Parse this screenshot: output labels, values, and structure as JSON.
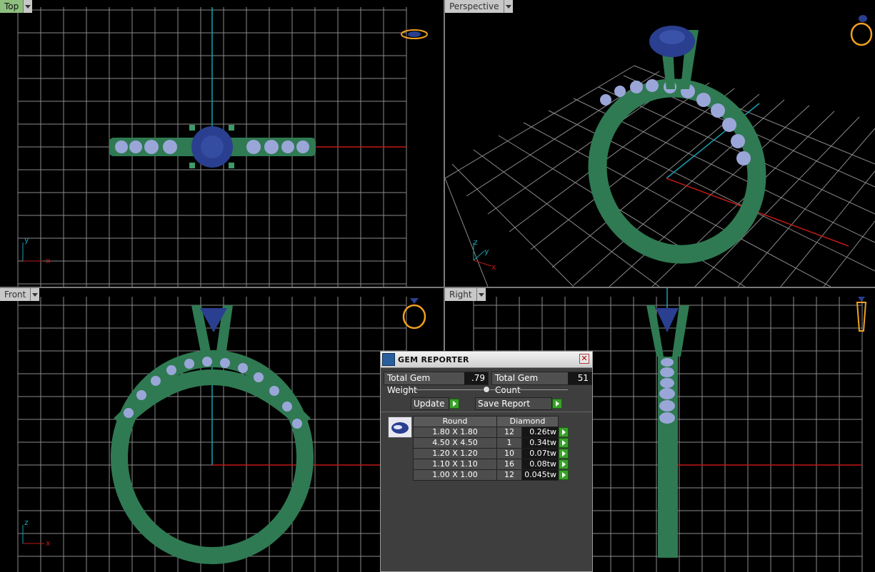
{
  "viewports": {
    "top": {
      "label": "Top",
      "axis_y": "y",
      "axis_x": "x"
    },
    "perspective": {
      "label": "Perspective",
      "axis_z": "z",
      "axis_y": "y",
      "axis_x": "x"
    },
    "front": {
      "label": "Front",
      "axis_z": "z",
      "axis_x": "x"
    },
    "right": {
      "label": "Right"
    }
  },
  "gem_reporter": {
    "title": "GEM REPORTER",
    "close": "✕",
    "total_weight_label": "Total Gem Weight",
    "total_weight_value": ".79",
    "total_count_label": "Total Gem Count",
    "total_count_value": "51",
    "update_label": "Update",
    "save_report_label": "Save Report",
    "table": {
      "headers": [
        "Round",
        "Diamond"
      ],
      "rows": [
        {
          "size": "1.80 X 1.80",
          "count": "12",
          "weight": "0.26tw"
        },
        {
          "size": "4.50 X 4.50",
          "count": "1",
          "weight": "0.34tw"
        },
        {
          "size": "1.20 X 1.20",
          "count": "10",
          "weight": "0.07tw"
        },
        {
          "size": "1.10 X 1.10",
          "count": "16",
          "weight": "0.08tw"
        },
        {
          "size": "1.00 X 1.00",
          "count": "12",
          "weight": "0.045tw"
        }
      ]
    }
  },
  "colors": {
    "metal": "#2f7a52",
    "center_stone": "#2a3f8f",
    "side_stones": "#9aa6d8",
    "grid": "#8a8a8a",
    "axis_x": "#c01818",
    "axis_y": "#18a0b0",
    "active_label": "#8fbf7f"
  },
  "icons": [
    "ring-nav-icon",
    "gem-reporter-icon",
    "close-icon",
    "go-arrow-icon"
  ]
}
